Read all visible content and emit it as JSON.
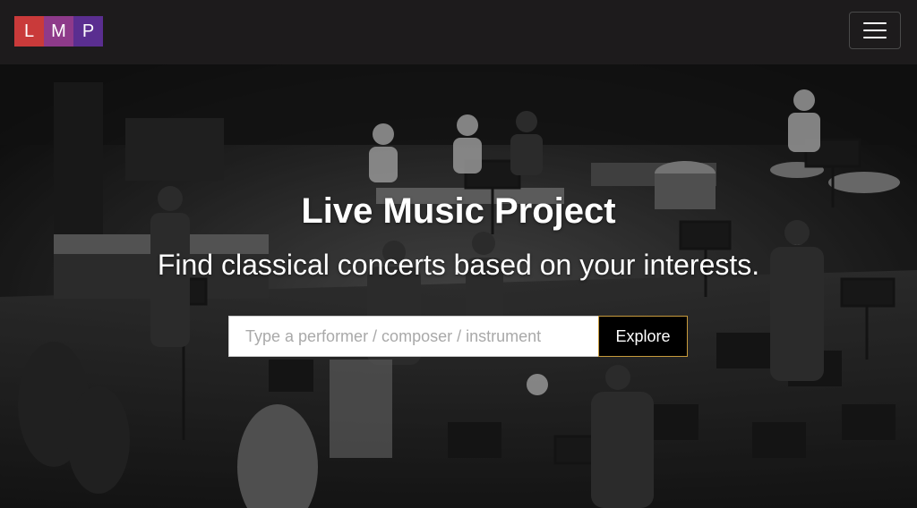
{
  "navbar": {
    "logo": {
      "letters": [
        {
          "char": "L",
          "color": "#c93a3a"
        },
        {
          "char": "M",
          "color": "#8e3a8a"
        },
        {
          "char": "P",
          "color": "#5a2e90"
        }
      ]
    },
    "menu_icon": "hamburger-icon"
  },
  "hero": {
    "background": "grayscale photo of an orchestra rehearsal on a stage",
    "title": "Live Music Project",
    "subtitle": "Find classical concerts based on your interests.",
    "search": {
      "placeholder": "Type a performer / composer / instrument",
      "value": "",
      "button_label": "Explore"
    }
  },
  "colors": {
    "navbar_bg": "#1d1b1c",
    "button_border": "#c79a3c",
    "button_bg": "#000000"
  }
}
